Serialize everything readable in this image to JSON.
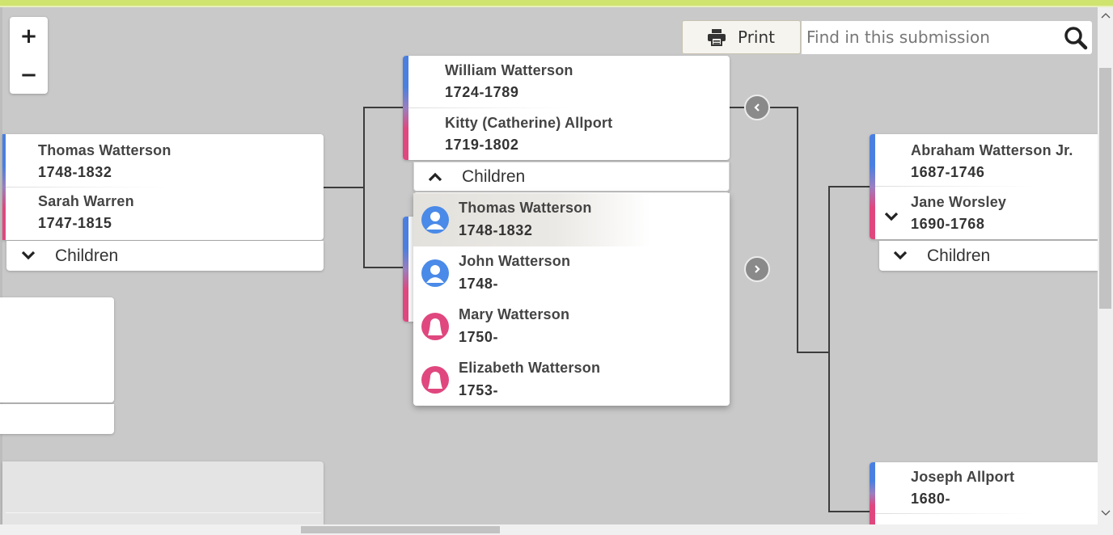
{
  "zoom": {
    "plus_label": "+",
    "minus_label": "−"
  },
  "toolbar": {
    "print_label": "Print",
    "search_placeholder": "Find in this submission"
  },
  "tree": {
    "focus_couple": {
      "husband": {
        "name": "Thomas Watterson",
        "dates": "1748-1832"
      },
      "wife": {
        "name": "Sarah Warren",
        "dates": "1747-1815"
      },
      "children_label": "Children"
    },
    "parents_couple": {
      "husband": {
        "name": "William Watterson",
        "dates": "1724-1789"
      },
      "wife": {
        "name": "Kitty (Catherine) Allport",
        "dates": "1719-1802"
      },
      "children_label": "Children",
      "children": [
        {
          "name": "Thomas Watterson",
          "dates": "1748-1832",
          "gender": "male"
        },
        {
          "name": "John Watterson",
          "dates": "1748-",
          "gender": "male"
        },
        {
          "name": "Mary Watterson",
          "dates": "1750-",
          "gender": "female"
        },
        {
          "name": "Elizabeth Watterson",
          "dates": "1753-",
          "gender": "female"
        }
      ]
    },
    "grandparents_couple": {
      "husband": {
        "name": "Abraham Watterson Jr.",
        "dates": "1687-1746"
      },
      "wife": {
        "name": "Jane Worsley",
        "dates": "1690-1768"
      },
      "children_label": "Children"
    },
    "other_grandparents": {
      "husband": {
        "name": "Joseph Allport",
        "dates": "1680-"
      }
    }
  },
  "colors": {
    "male": "#4a8ae8",
    "female": "#e0477e",
    "accent": "#cfe36f"
  },
  "icons": {
    "print": "printer-icon",
    "search": "search-icon",
    "prev": "chevron-left-icon",
    "next": "chevron-right-icon",
    "expand": "chevron-down-icon",
    "collapse": "chevron-up-icon"
  }
}
